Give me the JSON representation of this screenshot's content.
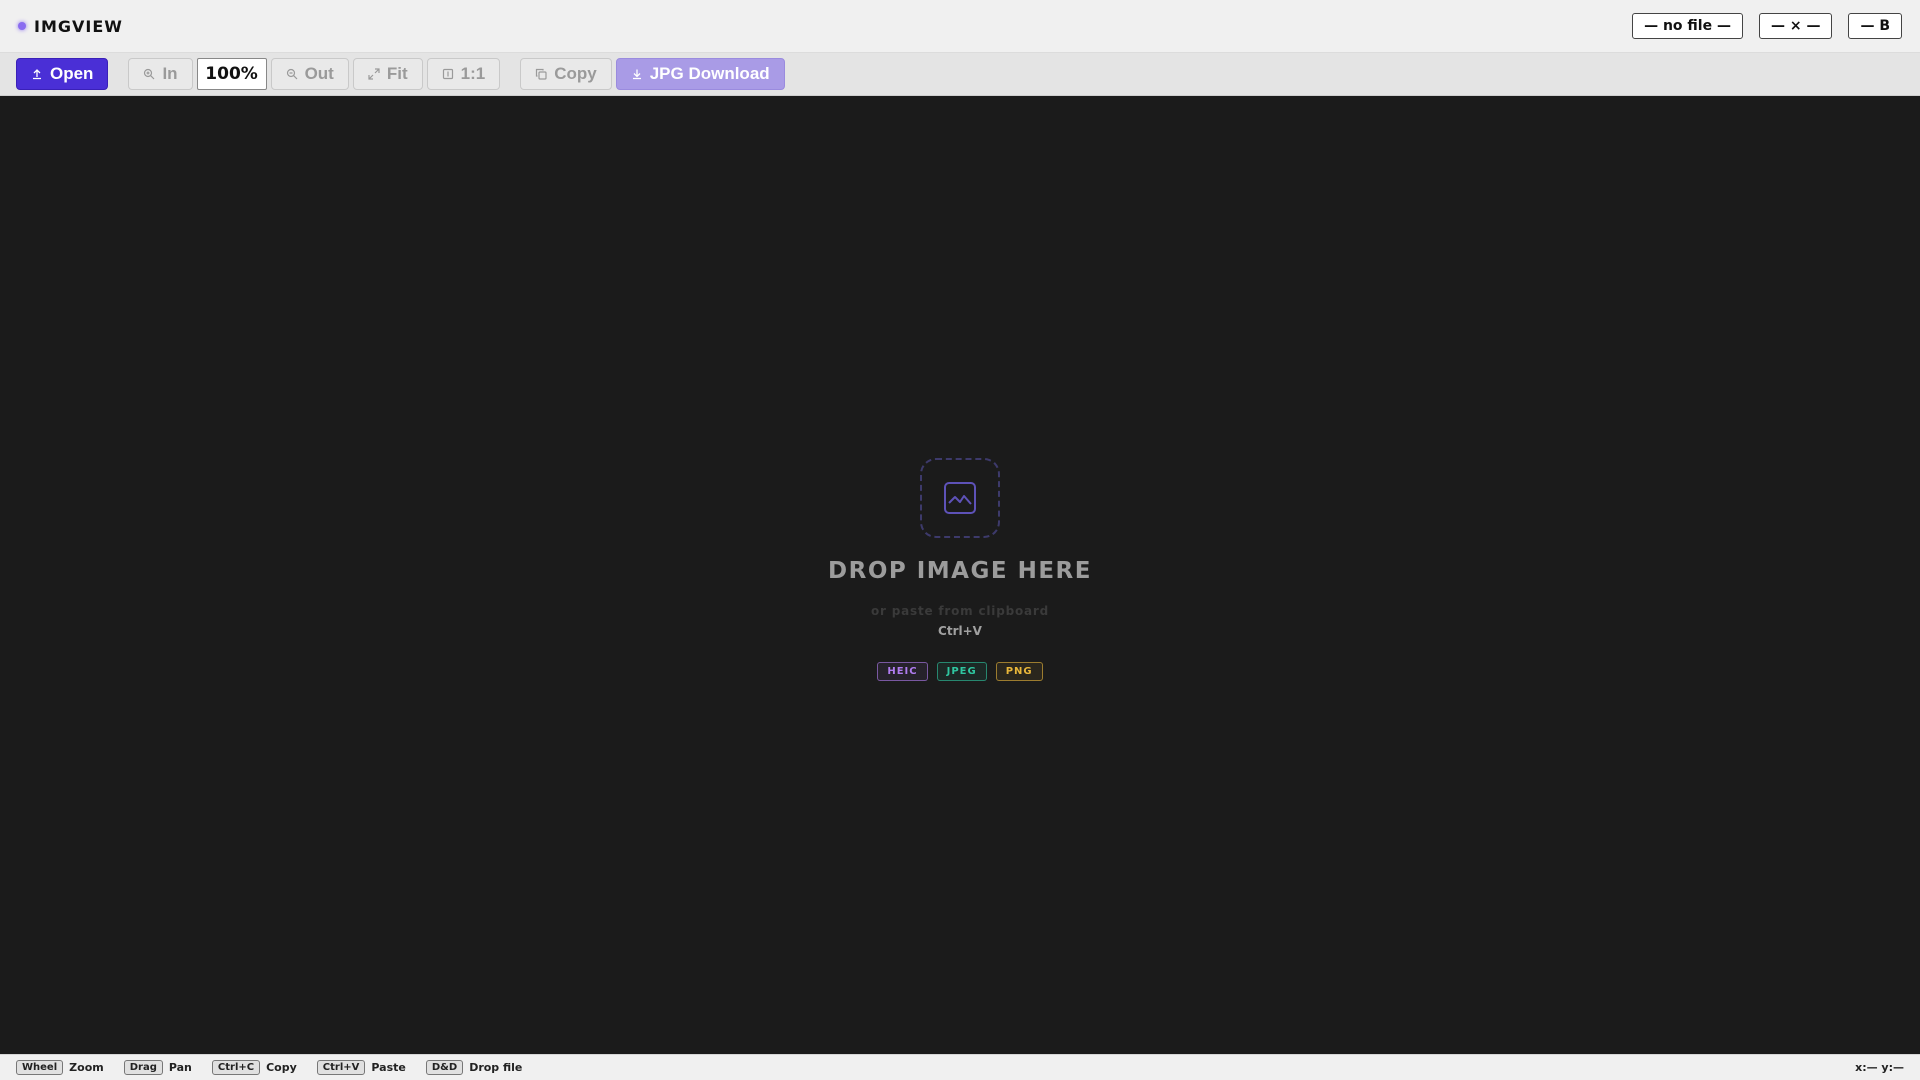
{
  "app": {
    "name": "IMGVIEW",
    "accent": "#8a6cf0"
  },
  "meta": {
    "file": "— no file —",
    "dims": "— × —",
    "size": "— B"
  },
  "toolbar": {
    "open_label": "Open",
    "zoom_in_label": "In",
    "zoom_value": "100%",
    "zoom_out_label": "Out",
    "fit_label": "Fit",
    "actual_label": "1:1",
    "copy_label": "Copy",
    "download_label": "JPG Download"
  },
  "drop": {
    "title": "DROP IMAGE HERE",
    "subtitle": "or paste from clipboard",
    "shortcut": "Ctrl+V",
    "formats": [
      {
        "label": "HEIC",
        "color": "#b07cf0"
      },
      {
        "label": "JPEG",
        "color": "#2fc6a0"
      },
      {
        "label": "PNG",
        "color": "#e8b63a"
      }
    ]
  },
  "status": {
    "hints": [
      {
        "key": "Wheel",
        "label": "Zoom"
      },
      {
        "key": "Drag",
        "label": "Pan"
      },
      {
        "key": "Ctrl+C",
        "label": "Copy"
      },
      {
        "key": "Ctrl+V",
        "label": "Paste"
      },
      {
        "key": "D&D",
        "label": "Drop file"
      }
    ],
    "coords": "x:— y:—"
  }
}
